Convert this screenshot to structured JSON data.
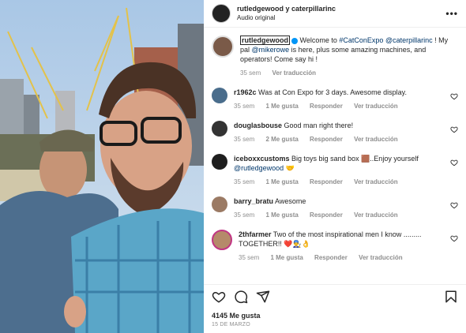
{
  "post": {
    "author": "rutledgewood y caterpillarinc",
    "audio": "Audio original"
  },
  "caption": {
    "username": "rutledgewood",
    "text_a": "Welcome to ",
    "hashtag": "#CatConExpo",
    "text_b": " ",
    "mention1": "@caterpillarinc",
    "text_c": " ! My pal ",
    "mention2": "@mikerowe",
    "text_d": " is here, plus some amazing machines, and operators! Come say hi !",
    "time": "35 sem",
    "translate": "Ver traducción"
  },
  "comments": [
    {
      "username": "r1962c",
      "text": "Was at Con Expo for 3 days. Awesome display.",
      "time": "35 sem",
      "likes": "1 Me gusta",
      "reply": "Responder",
      "translate": "Ver traducción"
    },
    {
      "username": "douglasbouse",
      "text": "Good man right there!",
      "time": "35 sem",
      "likes": "2 Me gusta",
      "reply": "Responder",
      "translate": "Ver traducción"
    },
    {
      "username": "iceboxxcustoms",
      "text": "Big toys big sand box 🟫..Enjoy yourself ",
      "mention": "@rutledgewood",
      "emoji": "🤝",
      "time": "35 sem",
      "likes": "1 Me gusta",
      "reply": "Responder",
      "translate": "Ver traducción"
    },
    {
      "username": "barry_bratu",
      "text": "Awesome",
      "time": "35 sem",
      "likes": "1 Me gusta",
      "reply": "Responder",
      "translate": "Ver traducción"
    },
    {
      "username": "2thfarmer",
      "text": "Two of the most inspirational men I know ......... TOGETHER!! ❤️👨‍🔧👌",
      "time": "35 sem",
      "likes": "1 Me gusta",
      "reply": "Responder",
      "translate": "Ver traducción"
    }
  ],
  "footer": {
    "likes": "4145 Me gusta",
    "date": "15 DE MARZO"
  },
  "icons": [
    "heart-icon",
    "comment-icon",
    "share-icon",
    "bookmark-icon",
    "more-icon"
  ],
  "colors": {
    "link": "#00376b",
    "muted": "#8e8e8e",
    "verified": "#0095f6"
  }
}
